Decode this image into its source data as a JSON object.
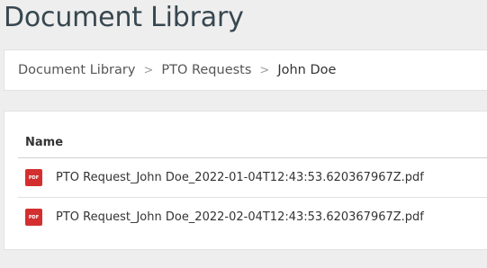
{
  "page": {
    "title": "Document Library"
  },
  "breadcrumb": {
    "items": [
      {
        "label": "Document Library"
      },
      {
        "label": "PTO Requests"
      },
      {
        "label": "John Doe"
      }
    ],
    "separator": ">"
  },
  "table": {
    "columns": [
      "Name"
    ],
    "rows": [
      {
        "name": "PTO Request_John Doe_2022-01-04T12:43:53.620367967Z.pdf",
        "icon": "pdf-icon",
        "icon_text": "PDF"
      },
      {
        "name": "PTO Request_John Doe_2022-02-04T12:43:53.620367967Z.pdf",
        "icon": "pdf-icon",
        "icon_text": "PDF"
      }
    ]
  },
  "colors": {
    "pdf_icon": "#d32f2f",
    "title": "#37474f",
    "background": "#eeeeee"
  }
}
